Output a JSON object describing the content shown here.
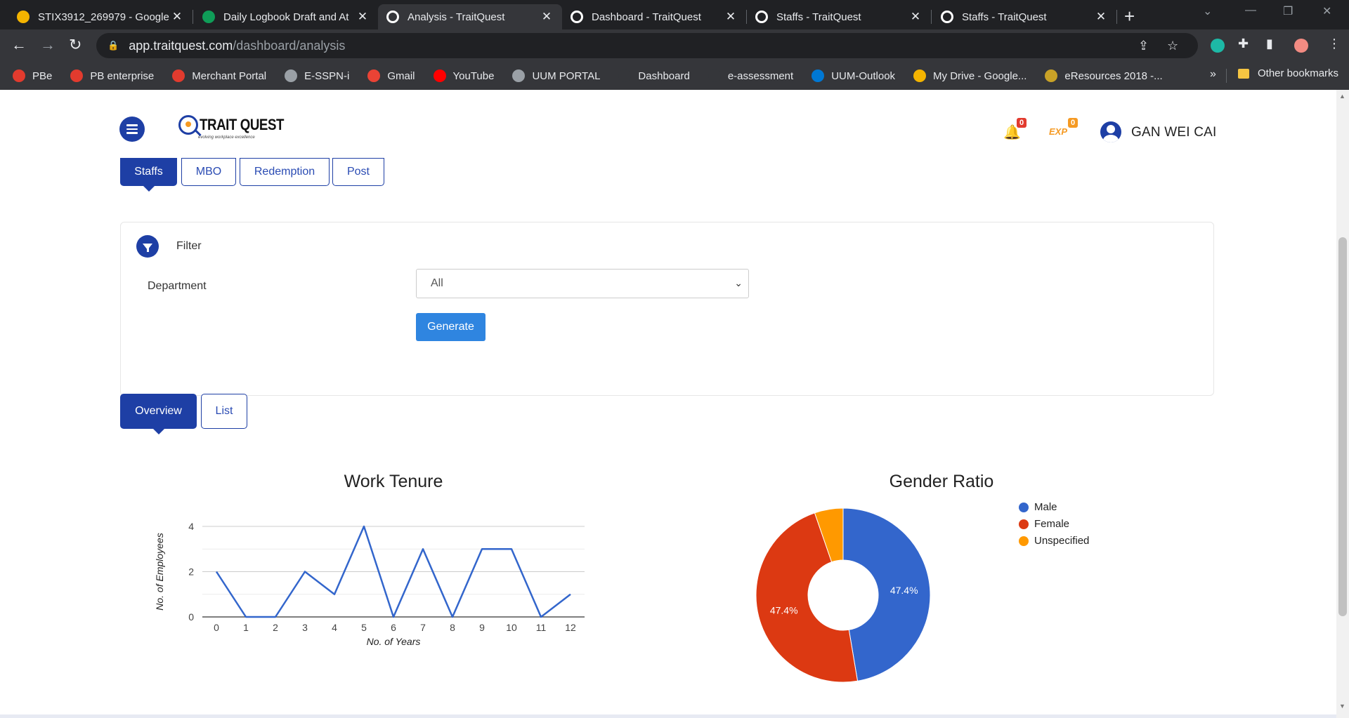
{
  "browser": {
    "tabs": [
      {
        "title": "STIX3912_269979 - Google",
        "icon": "google-drive-icon",
        "color": "#f4b400",
        "active": false
      },
      {
        "title": "Daily Logbook Draft and At",
        "icon": "sheets-icon",
        "color": "#0f9d58",
        "active": false
      },
      {
        "title": "Analysis - TraitQuest",
        "icon": "traitquest-icon",
        "color": "#ffffff",
        "active": true
      },
      {
        "title": "Dashboard - TraitQuest",
        "icon": "traitquest-icon",
        "color": "#ffffff",
        "active": false
      },
      {
        "title": "Staffs - TraitQuest",
        "icon": "traitquest-icon",
        "color": "#ffffff",
        "active": false
      },
      {
        "title": "Staffs - TraitQuest",
        "icon": "traitquest-icon",
        "color": "#ffffff",
        "active": false
      }
    ],
    "url_host": "app.traitquest.com",
    "url_path": "/dashboard/analysis",
    "bookmarks": [
      {
        "label": "PBe",
        "color": "#e23b2e"
      },
      {
        "label": "PB enterprise",
        "color": "#e23b2e"
      },
      {
        "label": "Merchant Portal",
        "color": "#e23b2e"
      },
      {
        "label": "E-SSPN-i",
        "color": "#9aa0a6"
      },
      {
        "label": "Gmail",
        "color": "#ea4335"
      },
      {
        "label": "YouTube",
        "color": "#ff0000"
      },
      {
        "label": "UUM PORTAL",
        "color": "#9aa0a6"
      },
      {
        "label": "Dashboard",
        "color": "#35363a"
      },
      {
        "label": "e-assessment",
        "color": "#35363a"
      },
      {
        "label": "UUM-Outlook",
        "color": "#0078d4"
      },
      {
        "label": "My Drive - Google...",
        "color": "#f4b400"
      },
      {
        "label": "eResources 2018 -...",
        "color": "#c9a227"
      }
    ],
    "bookmarks_more": "»",
    "other_bookmarks": "Other bookmarks"
  },
  "header": {
    "logo_text": "TRAIT QUEST",
    "logo_tagline": "evolving workplace excellence",
    "notifications_count": "0",
    "exp_label": "EXP",
    "exp_count": "0",
    "user_name": "GAN WEI CAI"
  },
  "top_tabs": [
    {
      "label": "Staffs",
      "active": true
    },
    {
      "label": "MBO",
      "active": false
    },
    {
      "label": "Redemption",
      "active": false
    },
    {
      "label": "Post",
      "active": false
    }
  ],
  "filter": {
    "title": "Filter",
    "department_label": "Department",
    "department_value": "All",
    "generate_label": "Generate"
  },
  "view_tabs": [
    {
      "label": "Overview",
      "active": true
    },
    {
      "label": "List",
      "active": false
    }
  ],
  "colors": {
    "primary": "#1e3fa5",
    "button": "#2f85e0",
    "line": "#3366cc",
    "male": "#3366cc",
    "female": "#dc3912",
    "unspecified": "#ff9900"
  },
  "chart_data": [
    {
      "type": "line",
      "title": "Work Tenure",
      "xlabel": "No. of Years",
      "ylabel": "No. of Employees",
      "x": [
        0,
        1,
        2,
        3,
        4,
        5,
        6,
        7,
        8,
        9,
        10,
        11,
        12
      ],
      "series": [
        {
          "values": [
            2,
            0,
            0,
            2,
            1,
            4,
            0,
            3,
            0,
            3,
            3,
            0,
            1
          ]
        }
      ],
      "yticks": [
        0,
        2,
        4
      ],
      "ylim": [
        0,
        4
      ],
      "grid": true
    },
    {
      "type": "pie",
      "title": "Gender Ratio",
      "donut": true,
      "labels": [
        "Male",
        "Female",
        "Unspecified"
      ],
      "values": [
        47.4,
        47.4,
        5.3
      ],
      "data_labels": [
        "47.4%",
        "47.4%",
        ""
      ],
      "legend": "right"
    }
  ]
}
